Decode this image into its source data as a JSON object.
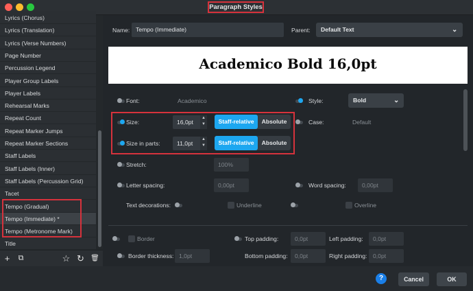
{
  "window": {
    "title": "Paragraph Styles"
  },
  "sidebar": {
    "items": [
      "Lyrics (Chorus)",
      "Lyrics (Translation)",
      "Lyrics (Verse Numbers)",
      "Page Number",
      "Percussion Legend",
      "Player Group Labels",
      "Player Labels",
      "Rehearsal Marks",
      "Repeat Count",
      "Repeat Marker Jumps",
      "Repeat Marker Sections",
      "Staff Labels",
      "Staff Labels (Inner)",
      "Staff Labels (Percussion Grid)",
      "Tacet",
      "Tempo (Gradual)",
      "Tempo (Immediate) *",
      "Tempo (Metronome Mark)",
      "Title"
    ],
    "selected_index": 16,
    "tools": {
      "add": "+",
      "duplicate": "⧉",
      "favorite": "☆",
      "reset": "↻",
      "delete": "🗑"
    }
  },
  "header": {
    "name_label": "Name:",
    "name_value": "Tempo (Immediate)",
    "parent_label": "Parent:",
    "parent_value": "Default Text"
  },
  "preview": {
    "text": "Academico Bold 16,0pt"
  },
  "props": {
    "font_label": "Font:",
    "font_value": "Academico",
    "style_label": "Style:",
    "style_value": "Bold",
    "size_label": "Size:",
    "size_value": "16,0pt",
    "case_label": "Case:",
    "case_value": "Default",
    "size_parts_label": "Size in parts:",
    "size_parts_value": "11,0pt",
    "staff_relative": "Staff-relative",
    "absolute": "Absolute",
    "stretch_label": "Stretch:",
    "stretch_value": "100%",
    "letter_spacing_label": "Letter spacing:",
    "letter_spacing_value": "0,00pt",
    "word_spacing_label": "Word spacing:",
    "word_spacing_value": "0,00pt",
    "text_decorations_label": "Text decorations:",
    "underline_label": "Underline",
    "overline_label": "Overline",
    "border_label": "Border",
    "top_padding_label": "Top padding:",
    "top_padding_value": "0,0pt",
    "left_padding_label": "Left padding:",
    "left_padding_value": "0,0pt",
    "border_thickness_label": "Border thickness:",
    "border_thickness_value": "1,0pt",
    "bottom_padding_label": "Bottom padding:",
    "bottom_padding_value": "0,0pt",
    "right_padding_label": "Right padding:",
    "right_padding_value": "0,0pt"
  },
  "footer": {
    "help": "?",
    "cancel": "Cancel",
    "ok": "OK"
  },
  "colors": {
    "accent": "#1da7f0",
    "highlight": "#d7323c",
    "ok_button": "#3e444a"
  }
}
